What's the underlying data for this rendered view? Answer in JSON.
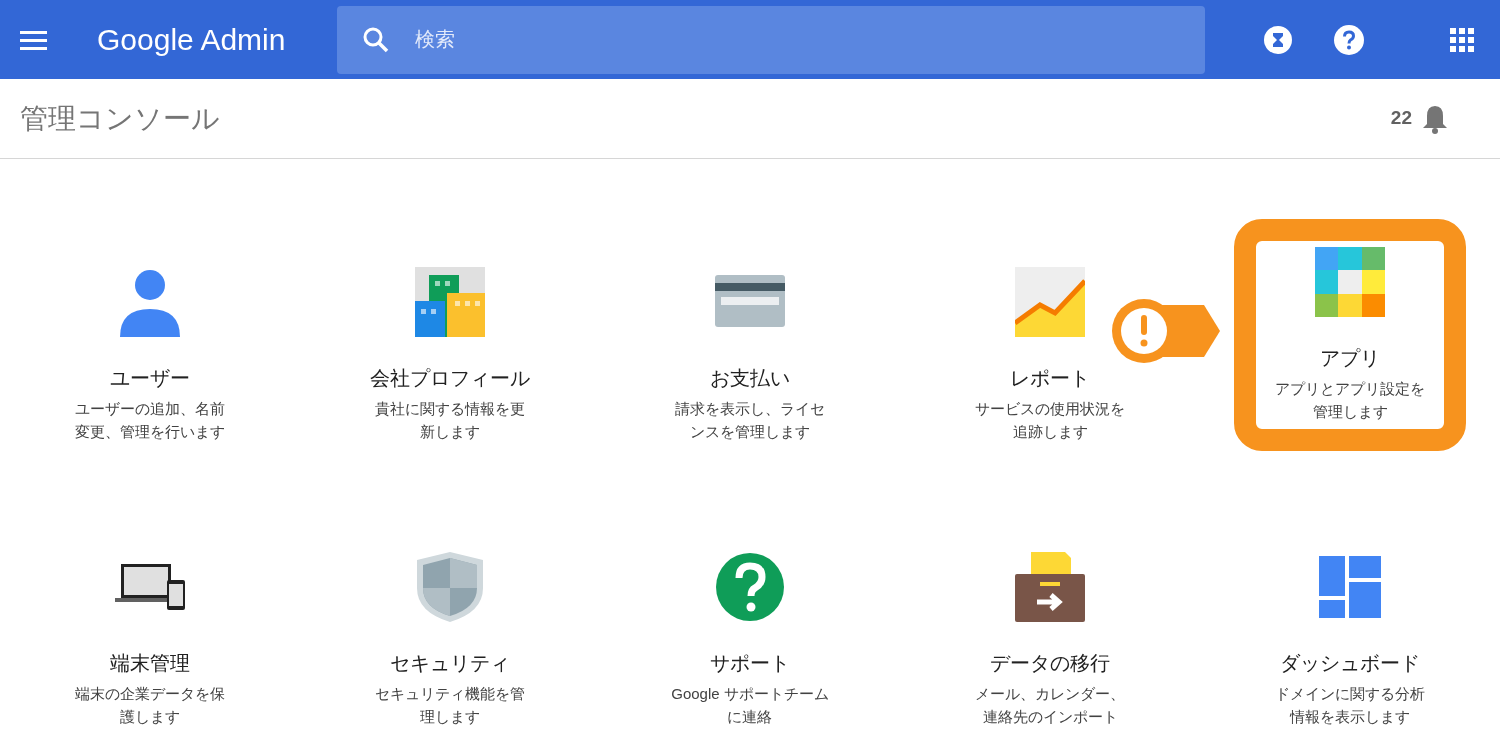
{
  "header": {
    "title": "Google Admin",
    "search": {
      "placeholder": "検索"
    }
  },
  "subheader": {
    "title": "管理コンソール",
    "notification_count": "22"
  },
  "cards": [
    {
      "kind": "user",
      "title": "ユーザー",
      "description": [
        "ユーザーの追加、名前",
        "変更、管理を行います"
      ],
      "highlighted": false
    },
    {
      "kind": "building",
      "title": "会社プロフィール",
      "description": [
        "貴社に関する情報を更",
        "新します"
      ],
      "highlighted": false
    },
    {
      "kind": "card",
      "title": "お支払い",
      "description": [
        "請求を表示し、ライセ",
        "ンスを管理します"
      ],
      "highlighted": false
    },
    {
      "kind": "chart",
      "title": "レポート",
      "description": [
        "サービスの使用状況を",
        "追跡します"
      ],
      "highlighted": false
    },
    {
      "kind": "apps",
      "title": "アプリ",
      "description": [
        "アプリとアプリ設定を",
        "管理します"
      ],
      "highlighted": true
    },
    {
      "kind": "devices",
      "title": "端末管理",
      "description": [
        "端末の企業データを保",
        "護します"
      ],
      "highlighted": false
    },
    {
      "kind": "shield",
      "title": "セキュリティ",
      "description": [
        "セキュリティ機能を管",
        "理します"
      ],
      "highlighted": false
    },
    {
      "kind": "help",
      "title": "サポート",
      "description": [
        "Google サポートチーム",
        "に連絡"
      ],
      "highlighted": false
    },
    {
      "kind": "folder",
      "title": "データの移行",
      "description": [
        "メール、カレンダー、",
        "連絡先のインポート"
      ],
      "highlighted": false
    },
    {
      "kind": "dashboard",
      "title": "ダッシュボード",
      "description": [
        "ドメインに関する分析",
        "情報を表示します"
      ],
      "highlighted": false
    }
  ]
}
